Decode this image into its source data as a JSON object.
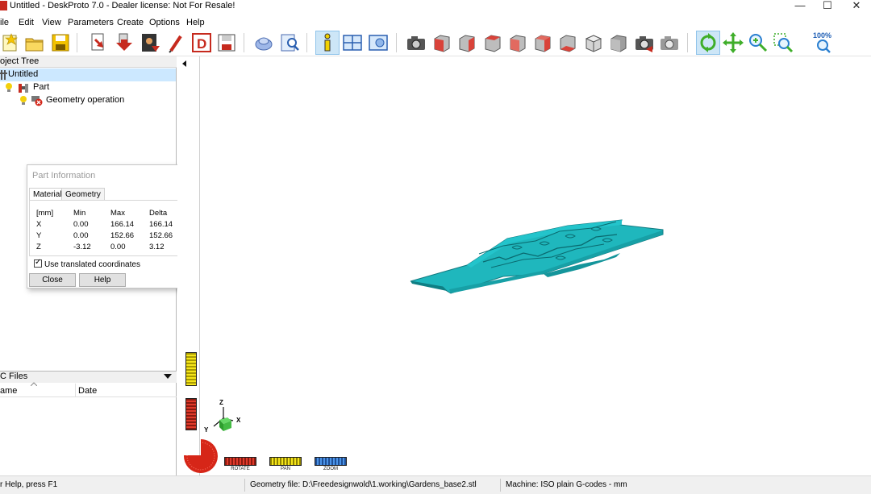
{
  "window": {
    "title": "Untitled - DeskProto 7.0 - Dealer license: Not For Resale!",
    "minimize_glyph": "—",
    "maximize_glyph": "☐",
    "close_glyph": "✕"
  },
  "menu": [
    "ile",
    "Edit",
    "View",
    "Parameters",
    "Create",
    "Options",
    "Help"
  ],
  "toolbar": {
    "zoom_label": "100%",
    "icons": [
      "new-file-icon",
      "open-folder-icon",
      "save-icon",
      "import-icon",
      "import-arrow-icon",
      "export-image-icon",
      "pen-icon",
      "deskproto-d-icon",
      "save-as-icon",
      "part-shape-icon",
      "part-search-icon",
      "info-icon",
      "layout-icon",
      "view-icon",
      "snapshot-camera-icon",
      "view-front-icon",
      "view-back-icon",
      "view-left-icon",
      "view-right-icon",
      "view-top-icon",
      "view-bottom-icon",
      "view-iso-icon",
      "view-gray-icon",
      "camera-red-icon",
      "camera-gray-icon",
      "rotate-tool-icon",
      "pan-tool-icon",
      "zoom-tool-icon",
      "zoom-window-icon",
      "zoom-100-icon"
    ]
  },
  "project_tree": {
    "header": "oject Tree",
    "items": [
      {
        "label": "Untitled",
        "selected": true
      },
      {
        "label": "Part"
      },
      {
        "label": "Geometry operation"
      }
    ]
  },
  "part_info": {
    "title": "Part Information",
    "tabs": [
      "Material",
      "Geometry"
    ],
    "columns": [
      "[mm]",
      "Min",
      "Max",
      "Delta"
    ],
    "rows": [
      {
        "axis": "X",
        "min": "0.00",
        "max": "166.14",
        "delta": "166.14"
      },
      {
        "axis": "Y",
        "min": "0.00",
        "max": "152.66",
        "delta": "152.66"
      },
      {
        "axis": "Z",
        "min": "-3.12",
        "max": "0.00",
        "delta": "3.12"
      }
    ],
    "checkbox_label": "Use translated coordinates",
    "close_label": "Close",
    "help_label": "Help"
  },
  "nc_files": {
    "header": "C Files",
    "col_name": "ame",
    "col_date": "Date"
  },
  "controls": {
    "rotate_label": "ROTATE",
    "pan_label": "PAN",
    "zoom_label": "ZOOM",
    "axis_z": "Z",
    "axis_y": "Y",
    "axis_x": "X"
  },
  "status": {
    "help": "r Help, press F1",
    "geometry_file": "Geometry file: D:\\Freedesignwold\\1.working\\Gardens_base2.stl",
    "machine": "Machine: ISO plain G-codes - mm"
  },
  "colors": {
    "part": "#1fb7bd",
    "part_dark": "#0e7f84",
    "tree_selection": "#cce8ff",
    "toolbar_active": "#cde6f7"
  }
}
